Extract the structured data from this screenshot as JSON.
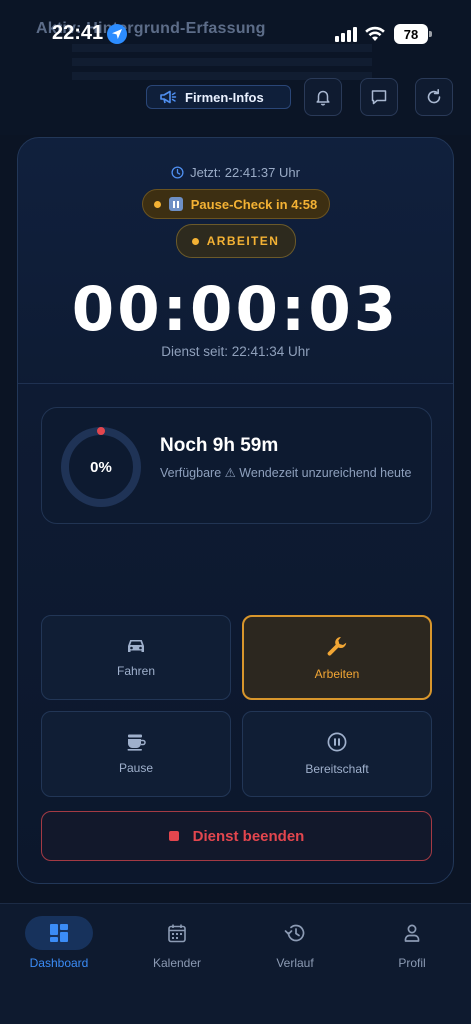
{
  "status_bar": {
    "time": "22:41",
    "battery": "78"
  },
  "background_banner": {
    "title": "Aktiv: Hintergrund-Erfassung"
  },
  "header": {
    "firmen_label": "Firmen-Infos"
  },
  "session": {
    "now_text": "Jetzt: 22:41:37 Uhr",
    "pause_check": "Pause-Check in 4:58",
    "status": "ARBEITEN",
    "timer": "00:00:03",
    "since": "Dienst seit: 22:41:34 Uhr"
  },
  "remaining": {
    "percent_label": "0%",
    "progress_fraction": 0,
    "title": "Noch 9h 59m",
    "subtitle": "Verfügbare ⚠ Wendezeit unzureichend heute"
  },
  "actions": [
    {
      "label": "Fahren",
      "icon": "car-icon"
    },
    {
      "label": "Arbeiten",
      "icon": "wrench-icon"
    },
    {
      "label": "Pause",
      "icon": "coffee-icon"
    },
    {
      "label": "Bereitschaft",
      "icon": "pause-circle-icon"
    }
  ],
  "end_button": "Dienst beenden",
  "tabs": [
    {
      "label": "Dashboard",
      "icon": "dashboard-icon",
      "active": true
    },
    {
      "label": "Kalender",
      "icon": "calendar-icon"
    },
    {
      "label": "Verlauf",
      "icon": "history-icon"
    },
    {
      "label": "Profil",
      "icon": "profile-icon"
    }
  ],
  "colors": {
    "accent_blue": "#3b8cf6",
    "active_orange": "#f2a634",
    "danger_red": "#e3464e"
  }
}
